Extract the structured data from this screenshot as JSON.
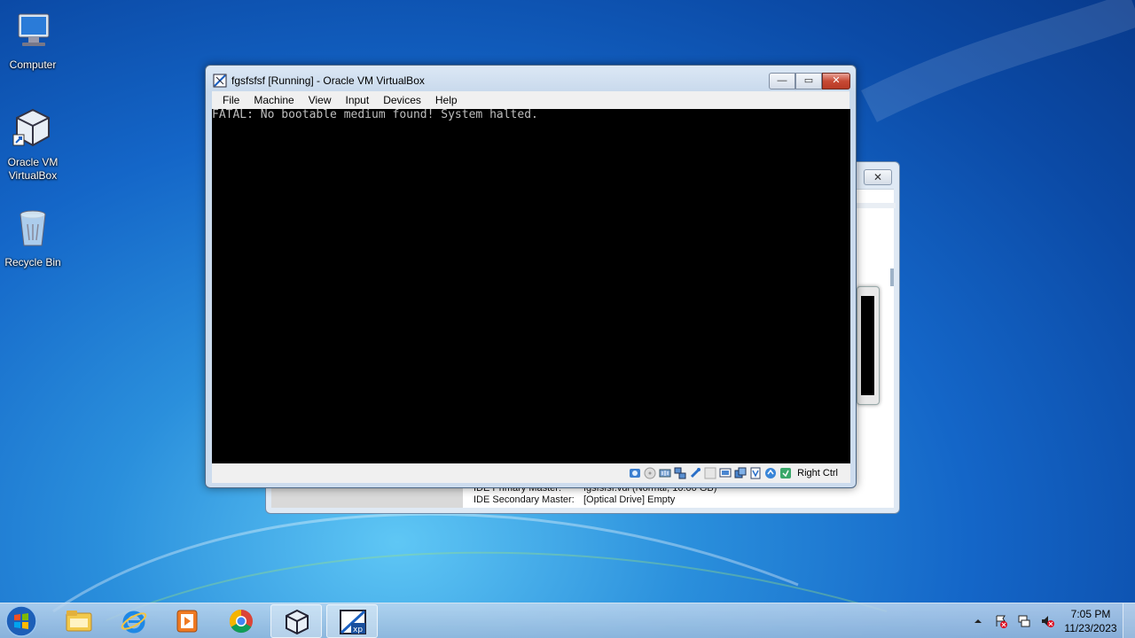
{
  "desktop": {
    "icons": [
      {
        "label": "Computer",
        "icon": "computer-icon"
      },
      {
        "label": "Oracle VM VirtualBox",
        "icon": "virtualbox-icon"
      },
      {
        "label": "Recycle Bin",
        "icon": "recycle-bin-icon"
      }
    ]
  },
  "manager_window": {
    "close_glyph": "✕",
    "details": [
      {
        "key": "IDE Primary Master:",
        "value": "fgsfsfsf.vdi (Normal, 10.00 GB)"
      },
      {
        "key": "IDE Secondary Master:",
        "value": "[Optical Drive] Empty"
      }
    ]
  },
  "vm_window": {
    "title": "fgsfsfsf [Running] - Oracle VM VirtualBox",
    "minimize_glyph": "—",
    "maximize_glyph": "▭",
    "close_glyph": "✕",
    "menu": [
      "File",
      "Machine",
      "View",
      "Input",
      "Devices",
      "Help"
    ],
    "console_text": "FATAL: No bootable medium found! System halted.",
    "status_icons": [
      "hard-disk-icon",
      "optical-drive-icon",
      "audio-icon",
      "network-icon",
      "usb-icon",
      "shared-folders-icon",
      "display-icon",
      "video-capture-icon",
      "virtualization-icon",
      "mouse-integration-icon",
      "cpu-icon"
    ],
    "host_key": "Right Ctrl"
  },
  "taskbar": {
    "apps": [
      "start-button",
      "file-explorer",
      "internet-explorer",
      "media-player",
      "chrome",
      "virtualbox-manager",
      "virtualbox-vm"
    ],
    "clock_time": "7:05 PM",
    "clock_date": "11/23/2023"
  },
  "colors": {
    "accent": "#1466c8",
    "console_text": "#bfbfbf"
  }
}
